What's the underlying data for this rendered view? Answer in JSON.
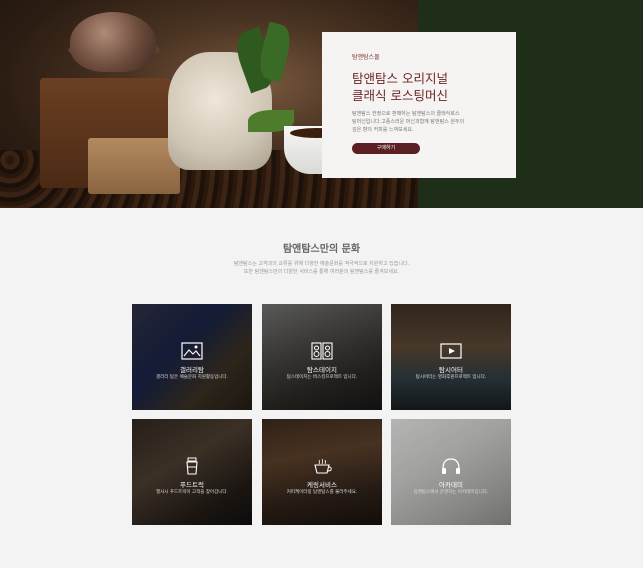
{
  "hero": {
    "kicker": "탐앤탐스몰",
    "title_line1": "탐앤탐스 오리지널",
    "title_line2": "클래식 로스팅머신",
    "desc_line1": "탐앤탐스 한정으로 판매하는 탐앤탐스의 클래식로스",
    "desc_line2": "팅머신입니다.고풍스러운 머신과함께 탐앤탐스 원두의",
    "desc_line3": "깊은 향의 커피를 느껴보세요.",
    "button_label": "구매하기"
  },
  "culture": {
    "title": "탐앤탐스만의 문화",
    "desc_line1": "탐앤탐스는 고객과의 교류를 위해 다양한 예술문화를 적극적으로 지원하고 있습니다.",
    "desc_line2": "또한 탐앤탐스만의 다양한 서비스를 통해 여러분의 탐앤탐스를 즐겨보세요.",
    "tiles": [
      {
        "title": "갤러리탐",
        "desc": "갤러리 탐은 예술문화 지원활동입니다.",
        "icon": "gallery-icon"
      },
      {
        "title": "탐스테이지",
        "desc": "탐스테이지는 버스킹프로젝트 입니다.",
        "icon": "stage-icon"
      },
      {
        "title": "탐시어터",
        "desc": "탐시어터는 영화후원프로젝트 입니다.",
        "icon": "theater-icon"
      },
      {
        "title": "푸드트럭",
        "desc": "행사시 푸드트럭이 고객을 찾아갑니다.",
        "icon": "food-truck-icon"
      },
      {
        "title": "케링서비스",
        "desc": "커피케이터링 탐앤탐스를 불러주세요.",
        "icon": "catering-icon"
      },
      {
        "title": "아카데미",
        "desc": "탐앤탐스에서 운영하는 아카데미입니다.",
        "icon": "headphones-icon"
      }
    ]
  }
}
